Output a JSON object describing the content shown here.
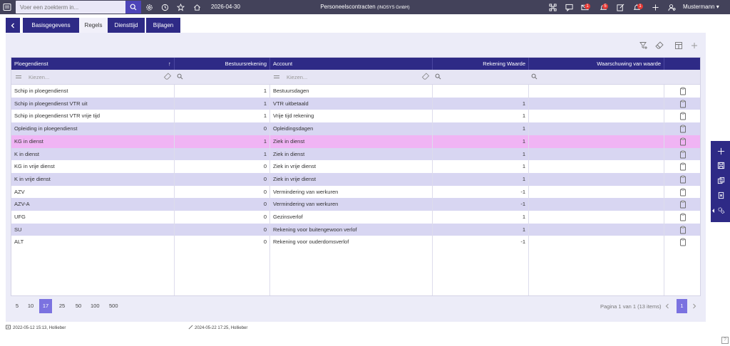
{
  "topbar": {
    "search_placeholder": "Voer een zoekterm in...",
    "date": "2026-04-30",
    "title": "Personeelscontracten",
    "company": "(INOSYS GmbH)",
    "badges": {
      "mail": "1",
      "notifications": "5",
      "alerts": "1"
    },
    "user": "Mustermann"
  },
  "tabs": [
    {
      "label": "Basisgegevens"
    },
    {
      "label": "Regels"
    },
    {
      "label": "Diensttijd"
    },
    {
      "label": "Bijlagen"
    }
  ],
  "grid": {
    "columns": {
      "ploegendienst": "Ploegendienst",
      "bestuursrekening": "Bestuursrekening",
      "account": "Account",
      "rekening_waarde": "Rekening Waarde",
      "waarschuwing": "Waarschuwing van waarde"
    },
    "filter_placeholder": "Kiezen...",
    "rows": [
      {
        "ploegendienst": "Schip in ploegendienst",
        "bestuursrekening": "1",
        "account": "Bestuursdagen",
        "waarde": ""
      },
      {
        "ploegendienst": "Schip in ploegendienst VTR uit",
        "bestuursrekening": "1",
        "account": "VTR uitbetaald",
        "waarde": "1"
      },
      {
        "ploegendienst": "Schip in ploegendienst VTR vrije tijd",
        "bestuursrekening": "1",
        "account": "Vrije tijd rekening",
        "waarde": "1"
      },
      {
        "ploegendienst": "Opleiding in ploegendienst",
        "bestuursrekening": "0",
        "account": "Opleidingsdagen",
        "waarde": "1"
      },
      {
        "ploegendienst": "KG in dienst",
        "bestuursrekening": "1",
        "account": "Ziek in dienst",
        "waarde": "1"
      },
      {
        "ploegendienst": "K in dienst",
        "bestuursrekening": "1",
        "account": "Ziek in dienst",
        "waarde": "1"
      },
      {
        "ploegendienst": "KG in vrije dienst",
        "bestuursrekening": "0",
        "account": "Ziek in vrije dienst",
        "waarde": "1"
      },
      {
        "ploegendienst": "K in vrije dienst",
        "bestuursrekening": "0",
        "account": "Ziek in vrije dienst",
        "waarde": "1"
      },
      {
        "ploegendienst": "AZV",
        "bestuursrekening": "0",
        "account": "Vermindering van werkuren",
        "waarde": "-1"
      },
      {
        "ploegendienst": "AZV-A",
        "bestuursrekening": "0",
        "account": "Vermindering van werkuren",
        "waarde": "-1"
      },
      {
        "ploegendienst": "UFG",
        "bestuursrekening": "0",
        "account": "Gezinsverlof",
        "waarde": "1"
      },
      {
        "ploegendienst": "SU",
        "bestuursrekening": "0",
        "account": "Rekening voor buitengewoon verlof",
        "waarde": "1"
      },
      {
        "ploegendienst": "ALT",
        "bestuursrekening": "0",
        "account": "Rekening voor ouderdomsverlof",
        "waarde": "-1"
      }
    ]
  },
  "pager": {
    "sizes": [
      "5",
      "10",
      "17",
      "25",
      "50",
      "100",
      "500"
    ],
    "selected_size": "17",
    "info": "Pagina 1 van 1 (13 items)",
    "current_page": "1"
  },
  "footer": {
    "created": "2022-05-12 15:13, Hollieber",
    "modified": "2024-05-22 17:25, Hollieber"
  },
  "colors": {
    "topbar": "#43425a",
    "primary": "#2e2a86",
    "row_alt": "#d8d6f2",
    "row_selected": "#f0b4f4",
    "pager_selected": "#7b72e0",
    "badge": "#e53935"
  }
}
